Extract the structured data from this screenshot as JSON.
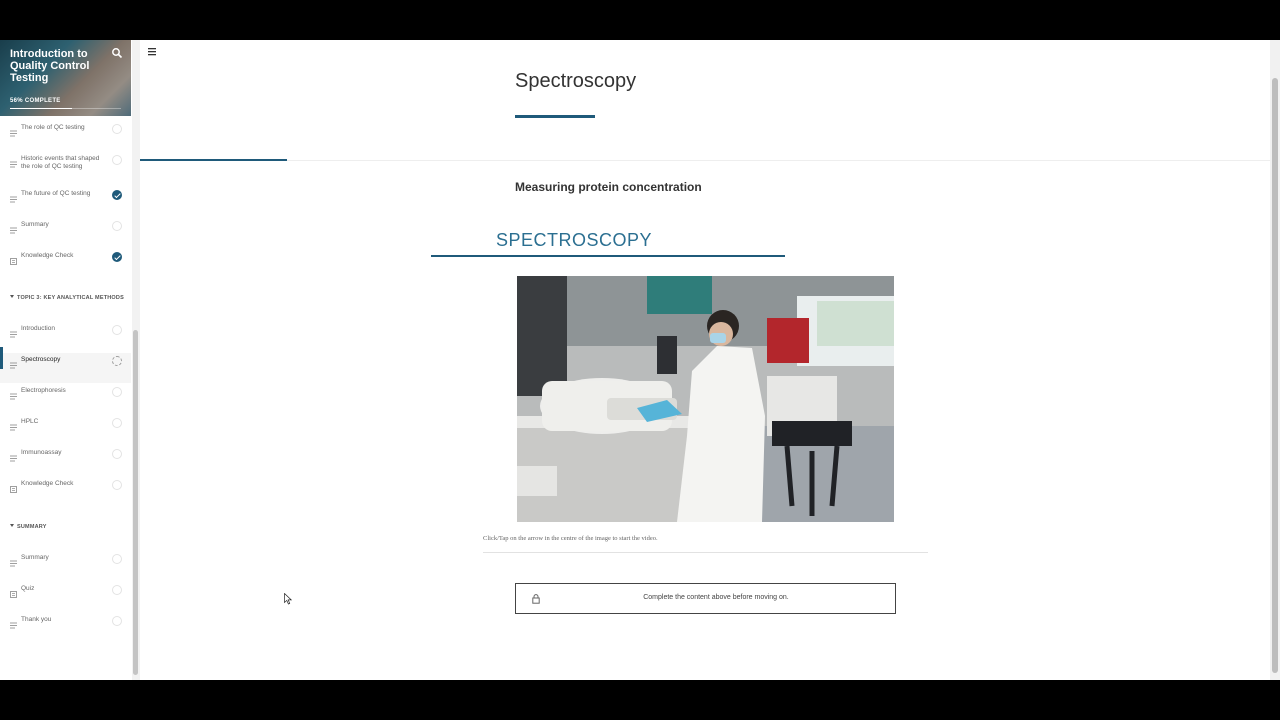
{
  "course": {
    "title": "Introduction to Quality Control Testing",
    "progress_label": "56% COMPLETE",
    "progress_fraction": 0.56
  },
  "sidebar": {
    "lessons_top": [
      {
        "label": "The role of QC testing",
        "icon": "lines-icon",
        "status": "incomplete"
      },
      {
        "label": "Historic events that shaped the role of QC testing",
        "icon": "lines-icon",
        "status": "incomplete"
      },
      {
        "label": "The future of QC testing",
        "icon": "lines-icon",
        "status": "complete"
      },
      {
        "label": "Summary",
        "icon": "lines-icon",
        "status": "incomplete"
      },
      {
        "label": "Knowledge Check",
        "icon": "quiz-icon",
        "status": "complete"
      }
    ],
    "topic3": {
      "heading": "TOPIC 3: KEY ANALYTICAL METHODS",
      "lessons": [
        {
          "label": "Introduction",
          "icon": "lines-icon",
          "status": "incomplete"
        },
        {
          "label": "Spectroscopy",
          "icon": "lines-icon",
          "status": "in-progress"
        },
        {
          "label": "Electrophoresis",
          "icon": "lines-icon",
          "status": "incomplete"
        },
        {
          "label": "HPLC",
          "icon": "lines-icon",
          "status": "incomplete"
        },
        {
          "label": "Immunoassay",
          "icon": "lines-icon",
          "status": "incomplete"
        },
        {
          "label": "Knowledge Check",
          "icon": "quiz-icon",
          "status": "incomplete"
        }
      ]
    },
    "summary": {
      "heading": "SUMMARY",
      "lessons": [
        {
          "label": "Summary",
          "icon": "lines-icon",
          "status": "incomplete"
        },
        {
          "label": "Quiz",
          "icon": "quiz-icon",
          "status": "incomplete"
        },
        {
          "label": "Thank you",
          "icon": "lines-icon",
          "status": "incomplete"
        }
      ]
    }
  },
  "main": {
    "lesson_title": "Spectroscopy",
    "subheading": "Measuring protein concentration",
    "section_heading": "SPECTROSCOPY",
    "video_instruction": "Click/Tap on the arrow in the centre of the image to start the video.",
    "locked_message": "Complete the content above before moving on."
  },
  "colors": {
    "accent": "#1f5a7a",
    "heading_blue": "#2b6f91"
  }
}
